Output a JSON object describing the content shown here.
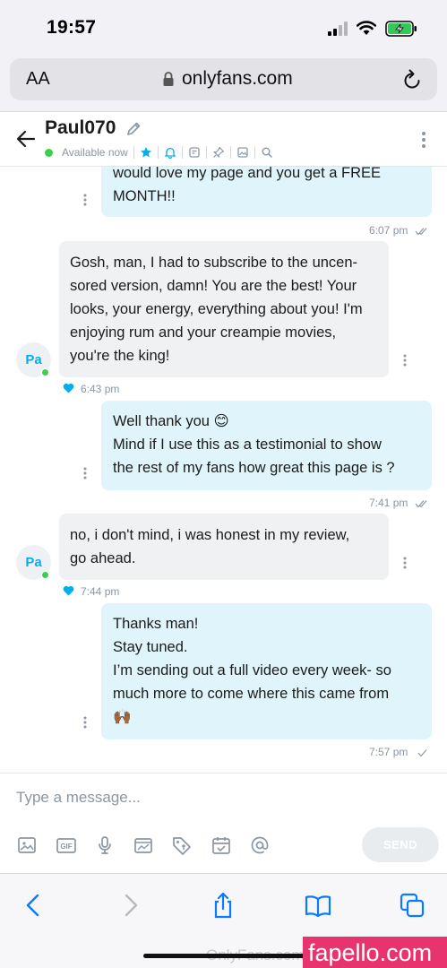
{
  "status_bar": {
    "time": "19:57"
  },
  "browser": {
    "text_size_label": "AA",
    "url": "onlyfans.com"
  },
  "chat": {
    "username": "Paul070",
    "status": "Available now"
  },
  "messages": [
    {
      "direction": "out",
      "lines": [
        "would love my page and you get a FREE",
        "MONTH!!"
      ],
      "time": "6:07 pm"
    },
    {
      "direction": "in",
      "avatar": "Pa",
      "lines": [
        "Gosh, man, I had to subscribe to the uncen-",
        "sored version, damn! You are the best! Your",
        "looks, your energy, everything about you! I'm",
        "enjoying rum and your creampie movies,",
        "you're the king!"
      ],
      "time": "6:43 pm",
      "liked": true
    },
    {
      "direction": "out",
      "lines": [
        "Well thank you 😊",
        "Mind if I use this as a testimonial to show",
        "the rest of my fans how great this page is ?"
      ],
      "time": "7:41 pm"
    },
    {
      "direction": "in",
      "avatar": "Pa",
      "lines": [
        "no, i don't mind, i was honest in my review,",
        "go ahead."
      ],
      "time": "7:44 pm",
      "liked": true
    },
    {
      "direction": "out",
      "lines": [
        "Thanks man!",
        "Stay tuned.",
        "I’m sending out a full video every week- so",
        "much more to come where this came from",
        "🙌🏾"
      ],
      "time": "7:57 pm"
    }
  ],
  "composer": {
    "placeholder": "Type a message...",
    "send_label": "SEND"
  },
  "watermark": {
    "site": "OnlyFans.com",
    "badge": "fapello.com"
  },
  "colors": {
    "accent": "#00aff0",
    "outgoing_bubble": "#dff5fb",
    "incoming_bubble": "#eff1f2",
    "online": "#3ccf4e",
    "safari_blue": "#0a7aff"
  }
}
